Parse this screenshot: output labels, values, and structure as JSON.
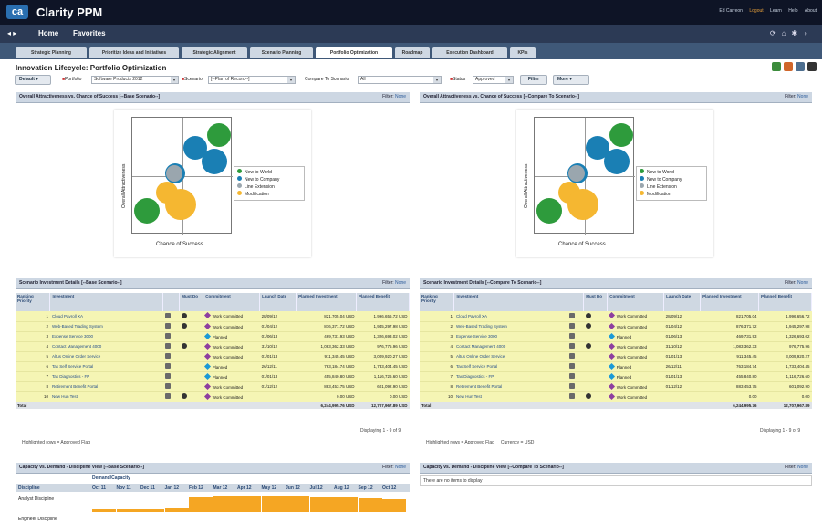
{
  "app": {
    "title": "Clarity PPM",
    "logo": "ca"
  },
  "user_links": {
    "user": "Ed Carreon",
    "logout": "Logout",
    "learn": "Learn",
    "help": "Help",
    "about": "About"
  },
  "nav": {
    "home": "Home",
    "favorites": "Favorites"
  },
  "tabs": [
    "Strategic Planning",
    "Prioritize Ideas and Initiatives",
    "Strategic Alignment",
    "Scenario Planning",
    "Portfolio Optimization",
    "Roadmap",
    "Execution Dashboard",
    "KPIs"
  ],
  "active_tab": "Portfolio Optimization",
  "page_title": "Innovation Lifecycle: Portfolio Optimization",
  "filters": {
    "default_label": "Default",
    "portfolio_label": "Portfolio",
    "portfolio_value": "Software Products 2012",
    "scenario_label": "Scenario",
    "scenario_value": "[--Plan of Record--]",
    "compare_label": "Compare To Scenario",
    "compare_value": "All",
    "status_label": "Status",
    "status_value": "Approved",
    "filter_btn": "Filter",
    "more_btn": "More"
  },
  "panels": {
    "bubble_base": "Overall Attractiveness vs. Chance of Success [--Base Scenario--]",
    "bubble_compare": "Overall Attractiveness vs. Chance of Success [--Compare To Scenario--]",
    "invest_base": "Scenario Investment Details [--Base Scenario--]",
    "invest_compare": "Scenario Investment Details [--Compare To Scenario--]",
    "cap_base": "Capacity vs. Demand - Discipline View [--Base Scenario--]",
    "cap_compare": "Capacity vs. Demand - Discipline View [--Compare To Scenario--]",
    "filter_label": "Filter:",
    "filter_value": "None"
  },
  "bubble_chart": {
    "y_label": "Overall Attractiveness",
    "x_label": "Chance of Success",
    "legend": [
      {
        "label": "New to World",
        "color": "#2e9b3c"
      },
      {
        "label": "New to Company",
        "color": "#1a7fb4"
      },
      {
        "label": "Line Extension",
        "color": "#9aa6ae"
      },
      {
        "label": "Modification",
        "color": "#f5b731"
      }
    ]
  },
  "investment_table": {
    "headers": [
      "Ranking Priority",
      "Investment",
      "",
      "Must Do",
      "Commitment",
      "Launch Date",
      "Planned Investment",
      "Planned Benefit"
    ],
    "rows": [
      {
        "rank": "1",
        "name": "Cloud Payroll XA",
        "must": true,
        "commit": "Work Committed",
        "commit_color": "#8e3fa0",
        "date": "28/09/12",
        "inv": "821,705.04 USD",
        "ben": "1,996,656.72 USD"
      },
      {
        "rank": "2",
        "name": "Web-Based Trading System",
        "must": true,
        "commit": "Work Committed",
        "commit_color": "#8e3fa0",
        "date": "01/04/12",
        "inv": "876,371.72 USD",
        "ben": "1,945,297.98 USD"
      },
      {
        "rank": "3",
        "name": "Expense Service 3000",
        "must": false,
        "commit": "Planned",
        "commit_color": "#1b9ad6",
        "date": "01/06/13",
        "inv": "469,731.93 USD",
        "ben": "1,326,693.02 USD"
      },
      {
        "rank": "4",
        "name": "Contact Management 4000",
        "must": true,
        "commit": "Work Committed",
        "commit_color": "#8e3fa0",
        "date": "31/10/12",
        "inv": "1,083,362.33 USD",
        "ben": "976,775.96 USD"
      },
      {
        "rank": "5",
        "name": "Altus Online Order Service",
        "must": false,
        "commit": "Work Committed",
        "commit_color": "#8e3fa0",
        "date": "01/01/13",
        "inv": "911,345.45 USD",
        "ben": "3,009,920.27 USD"
      },
      {
        "rank": "6",
        "name": "Tax Self Service Portal",
        "must": false,
        "commit": "Planned",
        "commit_color": "#1b9ad6",
        "date": "26/12/11",
        "inv": "763,184.74 USD",
        "ben": "1,733,404.45 USD"
      },
      {
        "rank": "7",
        "name": "Tax Diagnostics - FP",
        "must": false,
        "commit": "Planned",
        "commit_color": "#1b9ad6",
        "date": "01/01/13",
        "inv": "455,840.80 USD",
        "ben": "1,116,726.60 USD"
      },
      {
        "rank": "8",
        "name": "Retirement Benefit Portal",
        "must": false,
        "commit": "Work Committed",
        "commit_color": "#8e3fa0",
        "date": "01/12/12",
        "inv": "883,453.75 USD",
        "ben": "601,092.90 USD"
      },
      {
        "rank": "10",
        "name": "New Hun Test",
        "must": true,
        "commit": "Work Committed",
        "commit_color": "#8e3fa0",
        "date": "",
        "inv": "0.00 USD",
        "ben": "0.00 USD"
      }
    ],
    "total_label": "Total",
    "total_inv": "6,244,995.76 USD",
    "total_ben": "12,707,967.89 USD",
    "displaying": "Displaying 1 - 9 of 9"
  },
  "compare_table": {
    "rows": [
      {
        "inv": "821,705.04",
        "ben": "1,996,656.72"
      },
      {
        "inv": "876,371.72",
        "ben": "1,945,297.98"
      },
      {
        "inv": "469,731.93",
        "ben": "1,326,693.02"
      },
      {
        "inv": "1,083,362.33",
        "ben": "976,775.96"
      },
      {
        "inv": "911,345.45",
        "ben": "3,009,920.27"
      },
      {
        "inv": "763,184.74",
        "ben": "1,733,404.45"
      },
      {
        "inv": "455,840.80",
        "ben": "1,116,726.60"
      },
      {
        "inv": "883,453.75",
        "ben": "601,092.90"
      },
      {
        "inv": "0.00",
        "ben": "0.00"
      }
    ],
    "total_inv": "6,244,995.76",
    "total_ben": "12,707,967.89",
    "displaying": "Displaying 1 - 9 of 9"
  },
  "footnotes": {
    "base": "Highlighted rows = Approved Flag",
    "compare": "Highlighted rows = Approved Flag     Currency = USD"
  },
  "capacity": {
    "header_group": "Demand/Capacity",
    "col_discipline": "Discipline",
    "months": [
      "Oct 11",
      "Nov 11",
      "Dec 11",
      "Jan 12",
      "Feb 12",
      "Mar 12",
      "Apr 12",
      "May 12",
      "Jun 12",
      "Jul 12",
      "Aug 12",
      "Sep 12",
      "Oct 12"
    ],
    "rows": [
      "Analyst Discipline",
      "Engineer Discipline"
    ],
    "analyst_levels": [
      0.15,
      0.15,
      0.15,
      0.2,
      0.8,
      0.85,
      0.9,
      0.9,
      0.85,
      0.8,
      0.8,
      0.75,
      0.7
    ],
    "no_items": "There are no items to display"
  }
}
